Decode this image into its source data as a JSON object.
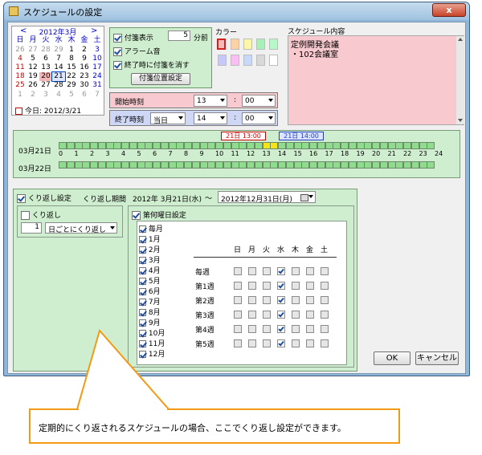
{
  "window": {
    "title": "スケジュールの設定",
    "close_label": "x"
  },
  "calendar": {
    "header": "2012年3月",
    "prev": "<",
    "next": ">",
    "weekdays": [
      "日",
      "月",
      "火",
      "水",
      "木",
      "金",
      "土"
    ],
    "weeks": [
      [
        "26",
        "27",
        "28",
        "29",
        "1",
        "2",
        "3"
      ],
      [
        "4",
        "5",
        "6",
        "7",
        "8",
        "9",
        "10"
      ],
      [
        "11",
        "12",
        "13",
        "14",
        "15",
        "16",
        "17"
      ],
      [
        "18",
        "19",
        "20",
        "21",
        "22",
        "23",
        "24"
      ],
      [
        "25",
        "26",
        "27",
        "28",
        "29",
        "30",
        "31"
      ],
      [
        "1",
        "2",
        "3",
        "4",
        "5",
        "6",
        "7"
      ]
    ],
    "today_label": "今日: 2012/3/21"
  },
  "reminder": {
    "show_label": "付箋表示",
    "minutes_value": "5",
    "minutes_unit": "分前",
    "alarm_label": "アラーム音",
    "erase_label": "終了時に付箋を消す",
    "position_button": "付箋位置設定"
  },
  "color": {
    "label": "カラー",
    "swatches": [
      "#f8b8b8",
      "#fbd2a5",
      "#fbf6a8",
      "#a8f0b8",
      "#b8f8c8",
      "#c8c8f8",
      "#f8c0f0",
      "#c8d8f8",
      "#d8d8d8",
      "#ffffff"
    ]
  },
  "memo": {
    "label": "スケジュール内容",
    "line1": "定例開発会議",
    "line2": "・102会議室"
  },
  "start_time": {
    "label": "開始時刻",
    "hour": "13",
    "sep": ":",
    "minute": "00"
  },
  "end_time": {
    "label": "終了時刻",
    "day": "当日",
    "hour": "14",
    "sep": ":",
    "minute": "00"
  },
  "timeline": {
    "start_marker": "21日 13:00",
    "end_marker": "21日 14:00",
    "row1_label": "03月21日",
    "row2_label": "03月22日",
    "hours": [
      "0",
      "1",
      "2",
      "3",
      "4",
      "5",
      "6",
      "7",
      "8",
      "9",
      "10",
      "11",
      "12",
      "13",
      "14",
      "15",
      "16",
      "17",
      "18",
      "19",
      "20",
      "21",
      "22",
      "23",
      "24"
    ]
  },
  "repeat": {
    "setting_label": "くり返し設定",
    "period_label": "くり返し期間",
    "period_start": "2012年 3月21日(水)",
    "tilde": "〜",
    "period_end": "2012年12月31日(月)",
    "repeat_label": "くり返し",
    "every_value": "1",
    "every_unit": "日ごとにくり返し",
    "week_setting_label": "第何曜日設定",
    "months": [
      "毎月",
      "1月",
      "2月",
      "3月",
      "4月",
      "5月",
      "6月",
      "7月",
      "8月",
      "9月",
      "10月",
      "11月",
      "12月"
    ],
    "dow_headers": [
      "日",
      "月",
      "火",
      "水",
      "木",
      "金",
      "土"
    ],
    "weeks": [
      "毎週",
      "第1週",
      "第2週",
      "第3週",
      "第4週",
      "第5週"
    ]
  },
  "buttons": {
    "ok": "OK",
    "cancel": "キャンセル"
  },
  "callout": {
    "text": "定期的にくり返されるスケジュールの場合、ここでくり返し設定ができます。"
  }
}
